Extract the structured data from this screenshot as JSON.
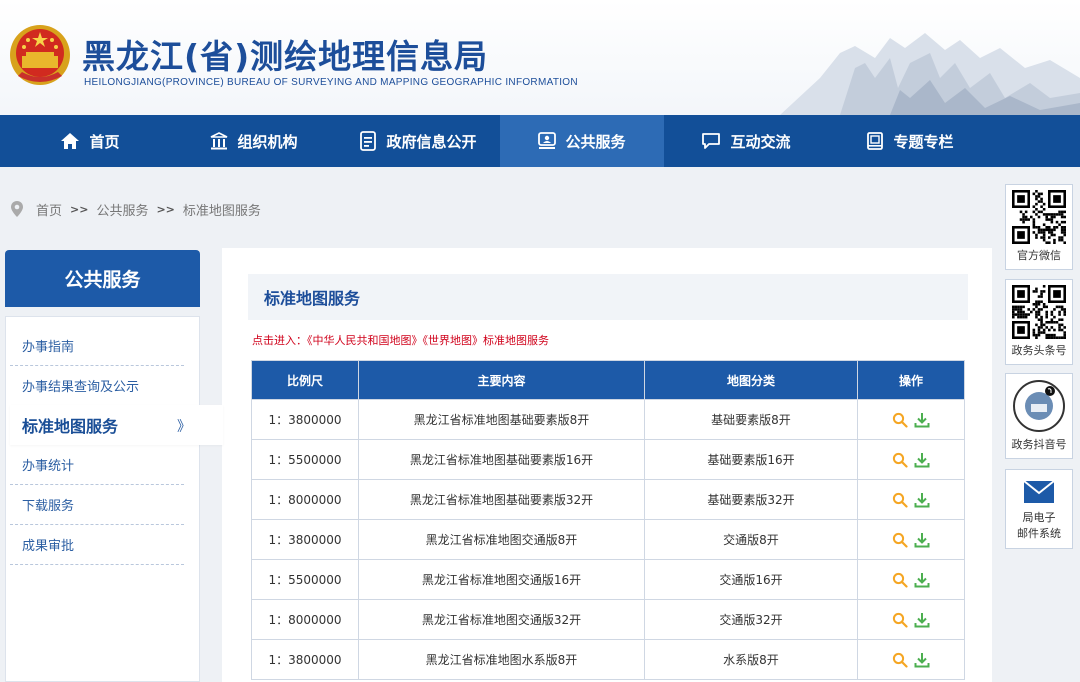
{
  "header": {
    "title": "黑龙江(省)测绘地理信息局",
    "subtitle": "HEILONGJIANG(PROVINCE) BUREAU OF SURVEYING AND MAPPING GEOGRAPHIC INFORMATION"
  },
  "nav": [
    {
      "label": "首页",
      "icon": "home-icon"
    },
    {
      "label": "组织机构",
      "icon": "building-icon"
    },
    {
      "label": "政府信息公开",
      "icon": "document-icon"
    },
    {
      "label": "公共服务",
      "icon": "service-icon",
      "active": true
    },
    {
      "label": "互动交流",
      "icon": "chat-icon"
    },
    {
      "label": "专题专栏",
      "icon": "book-icon"
    }
  ],
  "breadcrumb": {
    "home": "首页",
    "sep": ">>",
    "level1": "公共服务",
    "level2": "标准地图服务"
  },
  "sidebar": {
    "title": "公共服务",
    "items": [
      {
        "label": "办事指南"
      },
      {
        "label": "办事结果查询及公示"
      },
      {
        "label": "标准地图服务",
        "active": true
      },
      {
        "label": "办事统计"
      },
      {
        "label": "下载服务"
      },
      {
        "label": "成果审批"
      }
    ],
    "active_chevron": "》"
  },
  "main": {
    "title": "标准地图服务",
    "notice": "点击进入：《中华人民共和国地图》《世界地图》标准地图服务",
    "table": {
      "headers": [
        "比例尺",
        "主要内容",
        "地图分类",
        "操作"
      ],
      "rows": [
        {
          "scale": "1：3800000",
          "content": "黑龙江省标准地图基础要素版8开",
          "category": "基础要素版8开"
        },
        {
          "scale": "1：5500000",
          "content": "黑龙江省标准地图基础要素版16开",
          "category": "基础要素版16开"
        },
        {
          "scale": "1：8000000",
          "content": "黑龙江省标准地图基础要素版32开",
          "category": "基础要素版32开"
        },
        {
          "scale": "1：3800000",
          "content": "黑龙江省标准地图交通版8开",
          "category": "交通版8开"
        },
        {
          "scale": "1：5500000",
          "content": "黑龙江省标准地图交通版16开",
          "category": "交通版16开"
        },
        {
          "scale": "1：8000000",
          "content": "黑龙江省标准地图交通版32开",
          "category": "交通版32开"
        },
        {
          "scale": "1：3800000",
          "content": "黑龙江省标准地图水系版8开",
          "category": "水系版8开"
        }
      ]
    }
  },
  "right_panel": [
    {
      "label": "官方微信",
      "icon": "qr-code-icon"
    },
    {
      "label": "政务头条号",
      "icon": "qr-code-icon"
    },
    {
      "label": "政务抖音号",
      "icon": "qr-code-icon"
    },
    {
      "label": "局电子邮件系统",
      "label_line1": "局电子",
      "label_line2": "邮件系统",
      "icon": "mail-icon"
    }
  ],
  "colors": {
    "nav_bg": "#124f98",
    "nav_active": "#2d6bb5",
    "accent_blue": "#1d5aa8",
    "notice_red": "#d0021b",
    "search_icon": "#f5a623",
    "download_icon": "#4caf50"
  }
}
